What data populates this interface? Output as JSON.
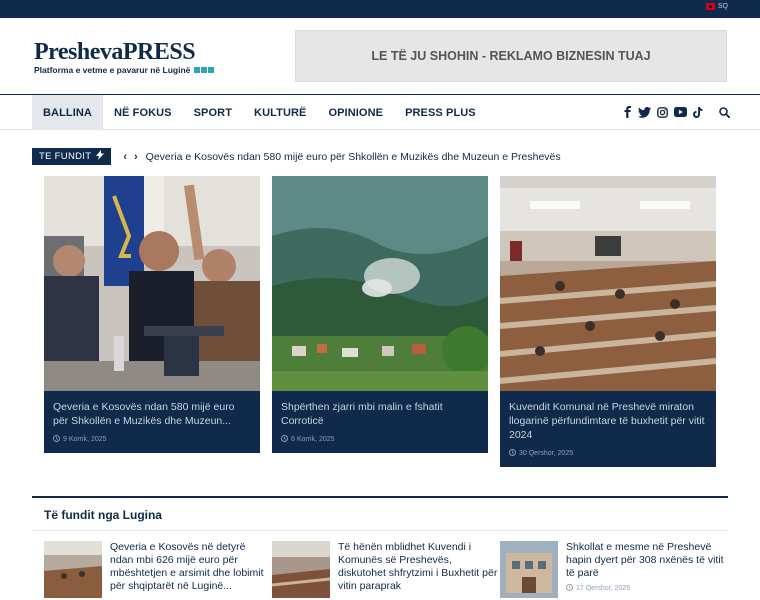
{
  "topbar": {
    "language": "SQ"
  },
  "logo": {
    "name": "PreshevaPRESS",
    "tagline": "Platforma e vetme e pavarur në Luginë"
  },
  "ad": {
    "text": "LE TË JU SHOHIN - REKLAMO BIZNESIN TUAJ"
  },
  "nav": {
    "items": [
      {
        "label": "BALLINA"
      },
      {
        "label": "NË FOKUS"
      },
      {
        "label": "SPORT"
      },
      {
        "label": "KULTURË"
      },
      {
        "label": "OPINIONE"
      },
      {
        "label": "PRESS PLUS"
      }
    ],
    "icons": [
      "facebook-icon",
      "twitter-icon",
      "instagram-icon",
      "youtube-icon",
      "tiktok-icon",
      "search-icon"
    ]
  },
  "ticker": {
    "label": "TE FUNDIT",
    "headline": "Qeveria e Kosovës ndan 580 mijë euro për Shkollën e Muzikës dhe Muzeun e Preshevës"
  },
  "featured": [
    {
      "title": "Qeveria e Kosovës ndan 580 mijë euro për Shkollën e Muzikës dhe Muzeun...",
      "date": "9 Korrik, 2025"
    },
    {
      "title": "Shpërthen zjarri mbi malin e fshatit Corroticë",
      "date": "6 Korrik, 2025"
    },
    {
      "title": "Kuvendit Komunal në Preshevë miraton llogarinë përfundimtare të buxhetit për vitit 2024",
      "date": "30 Qershor, 2025"
    }
  ],
  "section": {
    "title": "Të fundit nga Lugina"
  },
  "latest": [
    {
      "title": "Qeveria e Kosovës në detyrë ndan mbi 626 mijë euro për mbështetjen e arsimit dhe lobimit për shqiptarët në Luginë...",
      "date": ""
    },
    {
      "title": "Të hënën mblidhet Kuvendi i Komunës së Preshevës, diskutohet shfrytzimi i Buxhetit për vitin paraprak",
      "date": ""
    },
    {
      "title": "Shkollat e mesme në Preshevë hapin dyert për 308 nxënës të vitit të parë",
      "date": "17 Qershor, 2025"
    }
  ],
  "colors": {
    "primary": "#0f2a4a",
    "accent": "#2aa6b8"
  }
}
